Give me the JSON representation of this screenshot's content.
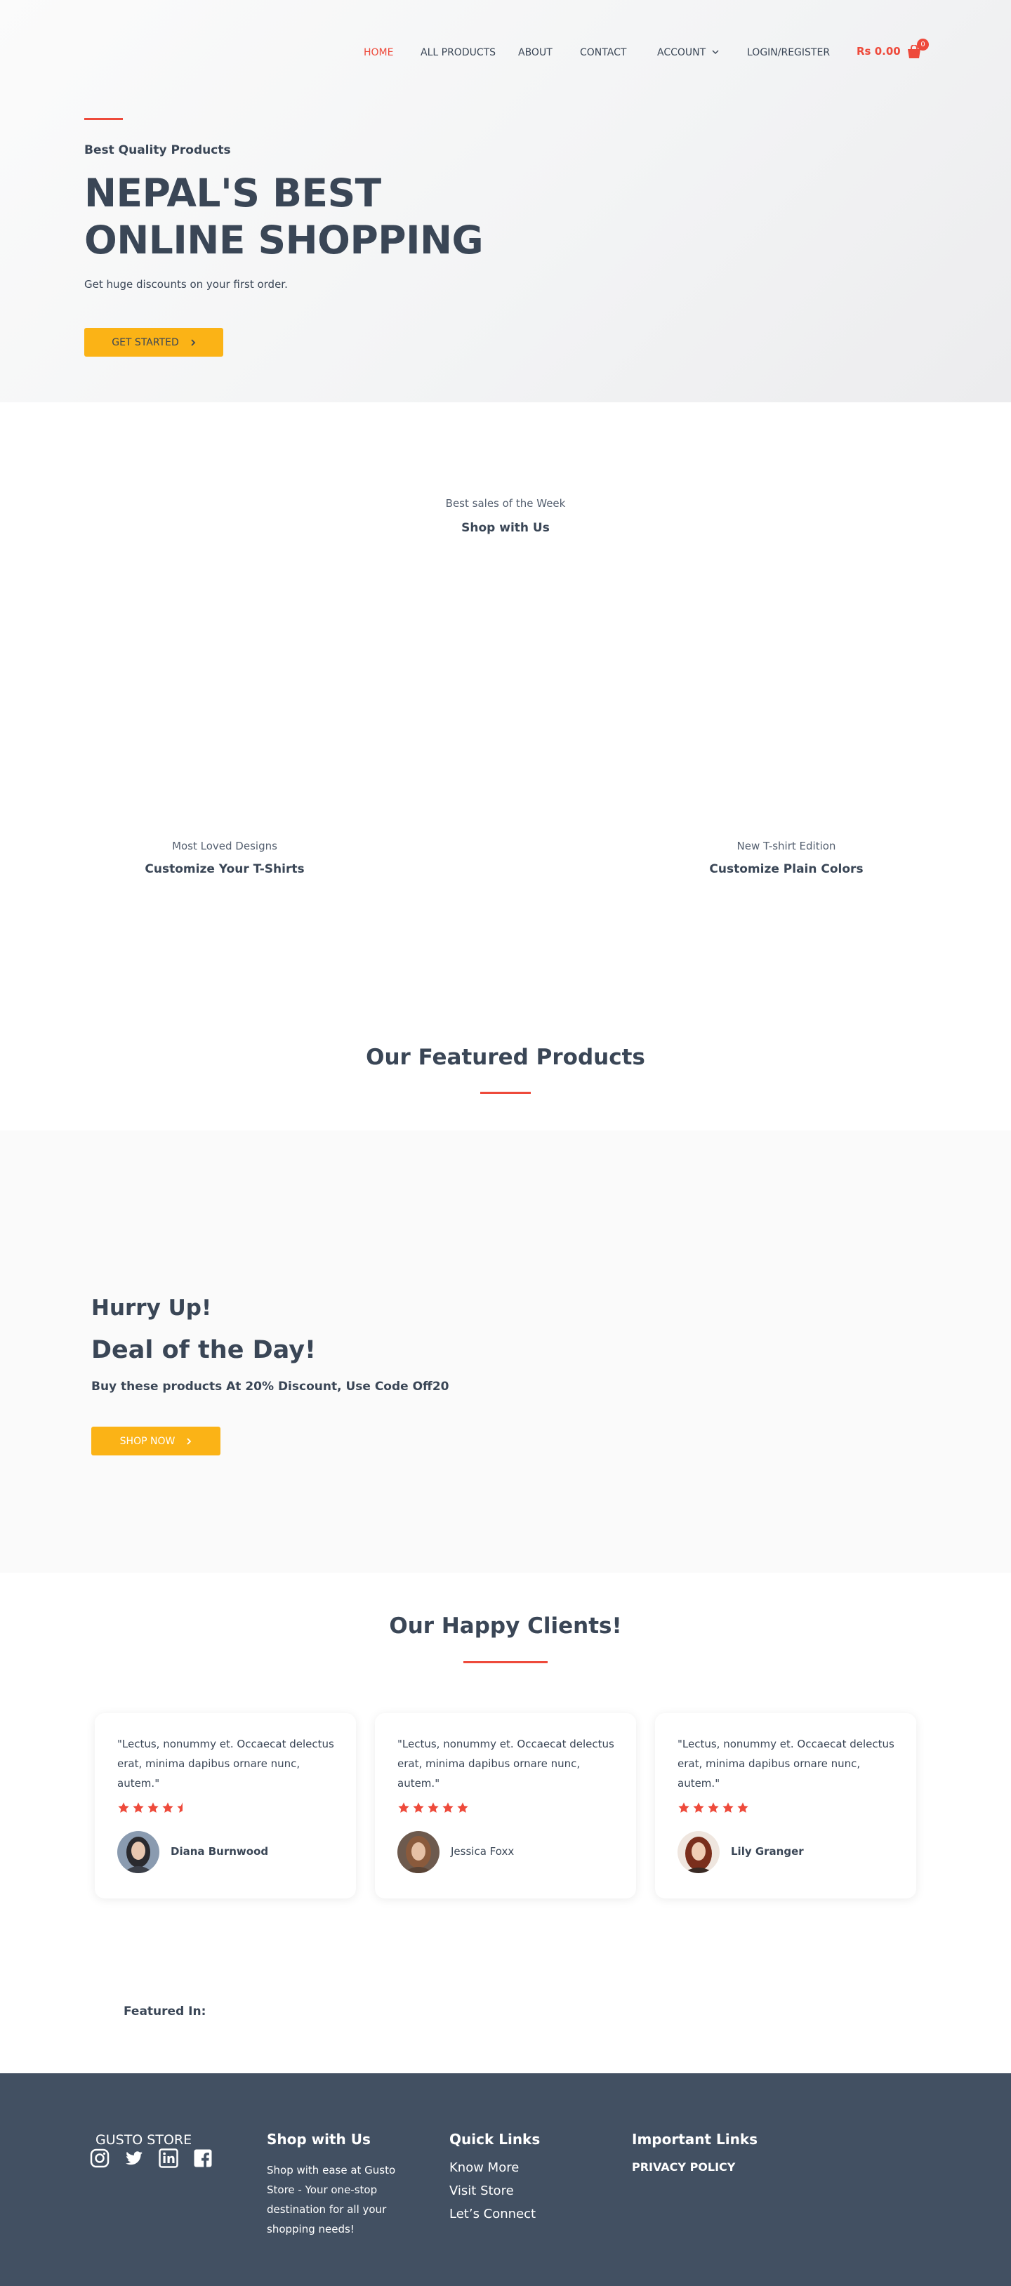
{
  "nav": {
    "items": [
      "HOME",
      "ALL PRODUCTS",
      "ABOUT",
      "CONTACT",
      "ACCOUNT",
      "LOGIN/REGISTER"
    ],
    "cart_total": "Rs 0.00",
    "cart_count": "0"
  },
  "hero": {
    "tagline": "Best Quality Products",
    "title_line1": "NEPAL'S BEST",
    "title_line2": "ONLINE SHOPPING",
    "subtitle": "Get huge discounts on your first order.",
    "cta_label": "GET STARTED"
  },
  "shop_section": {
    "kicker": "Best sales of the Week",
    "title": "Shop with Us"
  },
  "promo_left": {
    "kicker": "Most Loved Designs",
    "title": "Customize Your T-Shirts"
  },
  "promo_right": {
    "kicker": "New T-shirt Edition",
    "title": "Customize Plain Colors"
  },
  "featured": {
    "title": "Our Featured Products"
  },
  "deal": {
    "line1": "Hurry Up!",
    "line2": "Deal of the Day!",
    "description": "Buy these products At 20% Discount, Use Code Off20",
    "cta_label": "SHOP NOW"
  },
  "clients": {
    "title": "Our Happy Clients!",
    "testimonials": [
      {
        "quote": "\"Lectus, nonummy et. Occaecat delectus erat, minima dapibus ornare nunc, autem.\"",
        "rating": 4.5,
        "name": "Diana Burnwood"
      },
      {
        "quote": "\"Lectus, nonummy et. Occaecat delectus erat, minima dapibus ornare nunc, autem.\"",
        "rating": 5,
        "name": "Jessica Foxx"
      },
      {
        "quote": "\"Lectus, nonummy et. Occaecat delectus erat, minima dapibus ornare nunc, autem.\"",
        "rating": 5,
        "name": "Lily Granger"
      }
    ]
  },
  "featured_in": {
    "label": "Featured In:"
  },
  "footer": {
    "brand": "GUSTO STORE",
    "social_icons": [
      "instagram-icon",
      "twitter-icon",
      "linkedin-icon",
      "facebook-icon"
    ],
    "shop": {
      "heading": "Shop with Us",
      "text_lines": [
        "Shop with ease at Gusto",
        "Store - Your one-stop",
        "destination for all your",
        "shopping needs!"
      ]
    },
    "quick_links": {
      "heading": "Quick Links",
      "links": [
        "Know More",
        "Visit Store",
        "Let’s Connect"
      ]
    },
    "important_links": {
      "heading": "Important Links",
      "links": [
        "PRIVACY POLICY"
      ]
    }
  },
  "colors": {
    "accent_red": "#ee4a3b",
    "button_yellow": "#fbb316",
    "text_dark": "#3a4656",
    "footer_bg": "#425062"
  }
}
